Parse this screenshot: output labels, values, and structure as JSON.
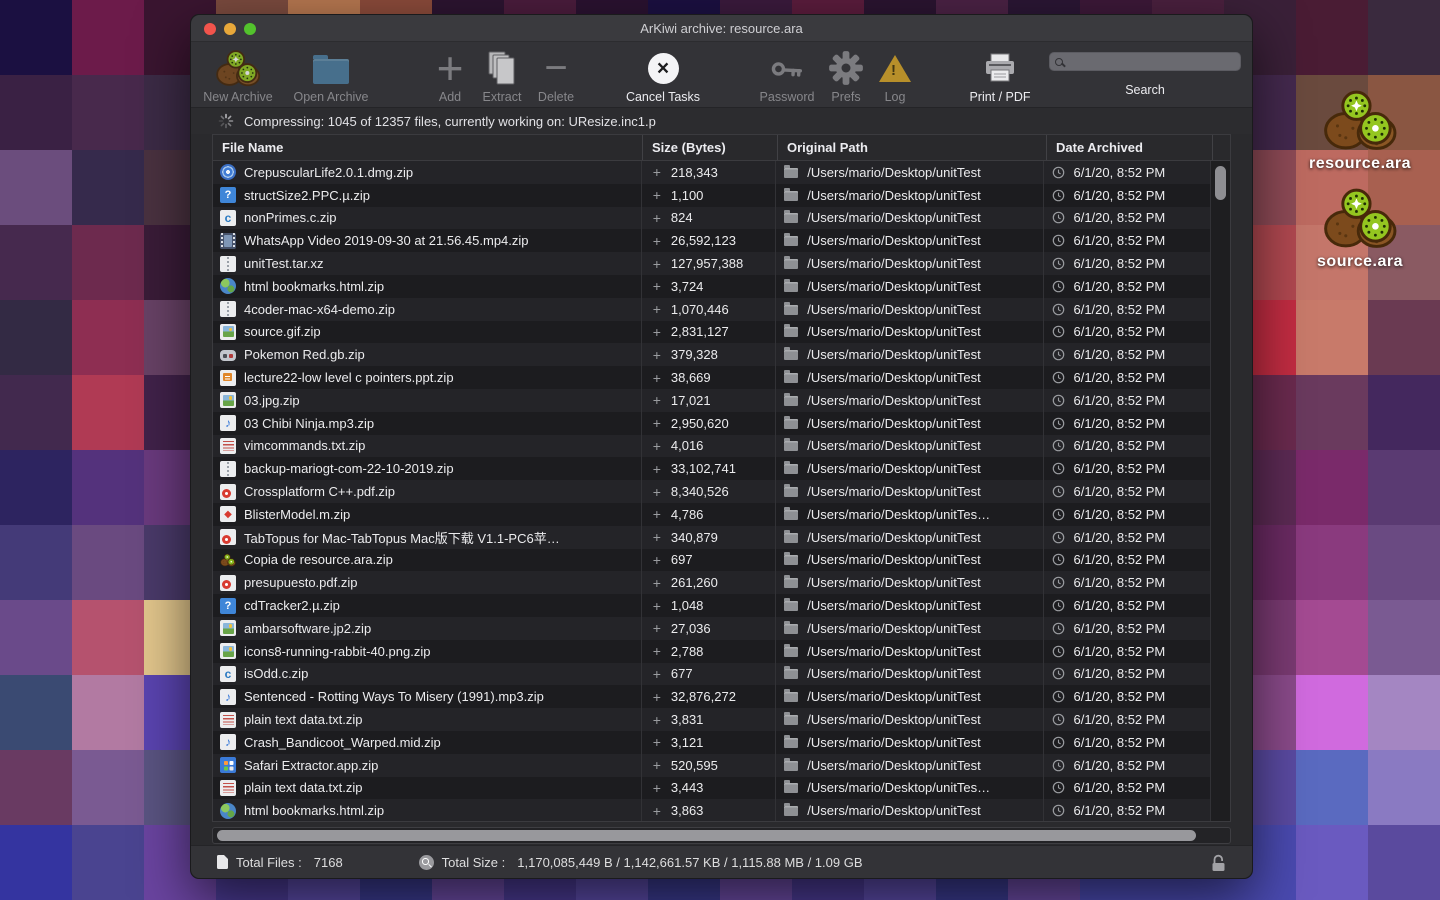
{
  "desktop": {
    "icons": [
      {
        "label": "resource.ara"
      },
      {
        "label": "source.ara"
      }
    ]
  },
  "background": {
    "tile_colors": [
      [
        "#1b1041",
        "#6c1b4a",
        "#3a1530",
        "#7a4a3e",
        "#b5764f",
        "#8a4a3a",
        "#2c1430",
        "#4a1c3c",
        "#2a1230",
        "#1b1041",
        "#3a1a3c",
        "#5a1c3c",
        "#2a1430",
        "#4a2244",
        "#2a1634",
        "#3c1838",
        "#4a203e",
        "#3a2038",
        "#4a1c34",
        "#3a2a3e"
      ],
      [
        "#3a2144",
        "#48294c",
        "#3c2b46",
        "#55305e",
        "#3a2348",
        "#54284e",
        "#42224a",
        "#2e1c3e",
        "#4a2a58",
        "#36204a",
        "#62325a",
        "#3c2444",
        "#502a52",
        "#44224e",
        "#3a2348",
        "#54284e",
        "#46284e",
        "#44294e",
        "#6a4a3e",
        "#8a5642"
      ],
      [
        "#6b4d7d",
        "#362a4c",
        "#4a3240",
        "#6a2a50",
        "#42224a",
        "#55305e",
        "#36204a",
        "#4a2a58",
        "#62325a",
        "#3c2444",
        "#502a52",
        "#44224e",
        "#3a2348",
        "#54284e",
        "#6a2a50",
        "#42224a",
        "#5c3050",
        "#8e4a56",
        "#bd6a60",
        "#a86050"
      ],
      [
        "#46294e",
        "#6d2a4e",
        "#3a1c38",
        "#54284e",
        "#6a2a50",
        "#36204a",
        "#55305e",
        "#3c2444",
        "#4a2a58",
        "#62325a",
        "#502a52",
        "#3a2348",
        "#44224e",
        "#6a2a50",
        "#54284e",
        "#7a3a5e",
        "#8e4252",
        "#b04850",
        "#c4766a",
        "#8a5a62"
      ],
      [
        "#332a44",
        "#8e2e52",
        "#684266",
        "#42224a",
        "#54284e",
        "#6a2a50",
        "#3c2444",
        "#55305e",
        "#36204a",
        "#4a2a58",
        "#62325a",
        "#502a52",
        "#3a2348",
        "#44224e",
        "#6a2a50",
        "#8a3a5e",
        "#a43a4e",
        "#c22c42",
        "#c87a6a",
        "#6a3a52"
      ],
      [
        "#42294e",
        "#b03a54",
        "#41224a",
        "#6a2a50",
        "#3c2444",
        "#54284e",
        "#55305e",
        "#36204a",
        "#62325a",
        "#4a2a58",
        "#502a52",
        "#44224e",
        "#3a2348",
        "#6a2a50",
        "#54284e",
        "#5c2a54",
        "#6a2a4e",
        "#6a2a4e",
        "#6a3a5e",
        "#44285e"
      ],
      [
        "#2d2460",
        "#54327c",
        "#6a3a7e",
        "#4a2a6a",
        "#55305e",
        "#3c2460",
        "#5a3270",
        "#44285e",
        "#4a2a58",
        "#62327a",
        "#502a6e",
        "#3a2360",
        "#44226a",
        "#6a2a72",
        "#54286a",
        "#5c2a64",
        "#5c2a54",
        "#5c2a54",
        "#7a2a6a",
        "#5a3a72"
      ],
      [
        "#443a78",
        "#6a4a80",
        "#4a3a6a",
        "#5a3a7e",
        "#4a2a6a",
        "#55307e",
        "#3c2460",
        "#5a3270",
        "#62327a",
        "#44285e",
        "#502a6e",
        "#4a2a58",
        "#3a2360",
        "#54286a",
        "#6a2a72",
        "#6a2a62",
        "#6a2a62",
        "#6a2a62",
        "#8a3a7e",
        "#6a4a82"
      ],
      [
        "#6a4a8a",
        "#b5526e",
        "#e2c68c",
        "#5a3a7e",
        "#55307e",
        "#4a2a6a",
        "#5a3270",
        "#3c2460",
        "#62327a",
        "#502a6e",
        "#44285e",
        "#3a2360",
        "#54286a",
        "#4a2a58",
        "#6a2a72",
        "#7a3a72",
        "#7a3a72",
        "#7a3a72",
        "#a44a92",
        "#7a5a92"
      ],
      [
        "#3a4a72",
        "#b27aa2",
        "#5a44b0",
        "#4a3a8a",
        "#5a3a7e",
        "#55307e",
        "#4a2a6a",
        "#5a3270",
        "#3c2460",
        "#62327a",
        "#502a6e",
        "#54286a",
        "#3a2360",
        "#44285e",
        "#6a2a72",
        "#8a4a8a",
        "#8a4a8a",
        "#8a4a8a",
        "#d06ade",
        "#a486c2"
      ],
      [
        "#693a62",
        "#7a5a92",
        "#5a5482",
        "#5a44b0",
        "#4a3a8a",
        "#5a3a7e",
        "#55307e",
        "#4a2a6a",
        "#5a3270",
        "#62327a",
        "#3c2460",
        "#502a6e",
        "#54286a",
        "#3a2360",
        "#44285e",
        "#5a4aa2",
        "#5a4aa2",
        "#5a4aa2",
        "#5a6ac0",
        "#8a7ac2"
      ],
      [
        "#3434a0",
        "#4a4490",
        "#6a44a0",
        "#4a3a92",
        "#5a4aa6",
        "#3a3a8e",
        "#6a4aa2",
        "#4a3a92",
        "#5a4aa6",
        "#3a3a8e",
        "#6a4aa2",
        "#4a3a92",
        "#5a4aa6",
        "#3a3a8e",
        "#6a4aa2",
        "#4a4ab0",
        "#4a4ab0",
        "#4a4ab0",
        "#6a5ac0",
        "#5a4a9e"
      ]
    ]
  },
  "window": {
    "title": "ArKiwi archive: resource.ara",
    "toolbar": {
      "items": [
        {
          "id": "new-archive",
          "label": "New Archive",
          "icon": "kiwi",
          "enabled": false
        },
        {
          "id": "open-archive",
          "label": "Open Archive",
          "icon": "folder",
          "enabled": false
        },
        {
          "id": "add",
          "label": "Add",
          "icon": "plus",
          "enabled": false
        },
        {
          "id": "extract",
          "label": "Extract",
          "icon": "docs",
          "enabled": false
        },
        {
          "id": "delete",
          "label": "Delete",
          "icon": "minus",
          "enabled": false
        },
        {
          "id": "cancel-tasks",
          "label": "Cancel Tasks",
          "icon": "cancel",
          "enabled": true
        },
        {
          "id": "password",
          "label": "Password",
          "icon": "key",
          "enabled": false
        },
        {
          "id": "prefs",
          "label": "Prefs",
          "icon": "gear",
          "enabled": false
        },
        {
          "id": "log",
          "label": "Log",
          "icon": "warning",
          "enabled": false
        },
        {
          "id": "print-pdf",
          "label": "Print / PDF",
          "icon": "printer",
          "enabled": true
        }
      ],
      "search_label": "Search",
      "search_value": ""
    },
    "progress": {
      "text": "Compressing: 1045 of 12357 files, currently working on:  UResize.inc1.p"
    },
    "table": {
      "columns": [
        "File Name",
        "Size (Bytes)",
        "Original Path",
        "Date Archived"
      ],
      "rows": [
        {
          "icon": "disc",
          "name": "CrepuscularLife2.0.1.dmg.zip",
          "size": "218,343",
          "path": "/Users/mario/Desktop/unitTest",
          "date": "6/1/20, 8:52 PM"
        },
        {
          "icon": "docq",
          "name": "structSize2.PPC.µ.zip",
          "size": "1,100",
          "path": "/Users/mario/Desktop/unitTest",
          "date": "6/1/20, 8:52 PM"
        },
        {
          "icon": "docc",
          "name": "nonPrimes.c.zip",
          "size": "824",
          "path": "/Users/mario/Desktop/unitTest",
          "date": "6/1/20, 8:52 PM"
        },
        {
          "icon": "video",
          "name": "WhatsApp Video 2019-09-30 at 21.56.45.mp4.zip",
          "size": "26,592,123",
          "path": "/Users/mario/Desktop/unitTest",
          "date": "6/1/20, 8:52 PM"
        },
        {
          "icon": "zip",
          "name": "unitTest.tar.xz",
          "size": "127,957,388",
          "path": "/Users/mario/Desktop/unitTest",
          "date": "6/1/20, 8:52 PM"
        },
        {
          "icon": "globe",
          "name": "html bookmarks.html.zip",
          "size": "3,724",
          "path": "/Users/mario/Desktop/unitTest",
          "date": "6/1/20, 8:52 PM"
        },
        {
          "icon": "zip",
          "name": "4coder-mac-x64-demo.zip",
          "size": "1,070,446",
          "path": "/Users/mario/Desktop/unitTest",
          "date": "6/1/20, 8:52 PM"
        },
        {
          "icon": "img",
          "name": "source.gif.zip",
          "size": "2,831,127",
          "path": "/Users/mario/Desktop/unitTest",
          "date": "6/1/20, 8:52 PM"
        },
        {
          "icon": "game",
          "name": "Pokemon Red.gb.zip",
          "size": "379,328",
          "path": "/Users/mario/Desktop/unitTest",
          "date": "6/1/20, 8:52 PM"
        },
        {
          "icon": "ppt",
          "name": "lecture22-low level c pointers.ppt.zip",
          "size": "38,669",
          "path": "/Users/mario/Desktop/unitTest",
          "date": "6/1/20, 8:52 PM"
        },
        {
          "icon": "img",
          "name": "03.jpg.zip",
          "size": "17,021",
          "path": "/Users/mario/Desktop/unitTest",
          "date": "6/1/20, 8:52 PM"
        },
        {
          "icon": "music",
          "name": "03 Chibi Ninja.mp3.zip",
          "size": "2,950,620",
          "path": "/Users/mario/Desktop/unitTest",
          "date": "6/1/20, 8:52 PM"
        },
        {
          "icon": "text",
          "name": "vimcommands.txt.zip",
          "size": "4,016",
          "path": "/Users/mario/Desktop/unitTest",
          "date": "6/1/20, 8:52 PM"
        },
        {
          "icon": "zip",
          "name": "backup-mariogt-com-22-10-2019.zip",
          "size": "33,102,741",
          "path": "/Users/mario/Desktop/unitTest",
          "date": "6/1/20, 8:52 PM"
        },
        {
          "icon": "pdf",
          "name": "Crossplatform C++.pdf.zip",
          "size": "8,340,526",
          "path": "/Users/mario/Desktop/unitTest",
          "date": "6/1/20, 8:52 PM"
        },
        {
          "icon": "docm",
          "name": "BlisterModel.m.zip",
          "size": "4,786",
          "path": "/Users/mario/Desktop/unitTes…",
          "date": "6/1/20, 8:52 PM"
        },
        {
          "icon": "pdf",
          "name": "TabTopus for Mac-TabTopus Mac版下载 V1.1-PC6苹…",
          "size": "340,879",
          "path": "/Users/mario/Desktop/unitTest",
          "date": "6/1/20, 8:52 PM"
        },
        {
          "icon": "kiwi",
          "name": "Copia de resource.ara.zip",
          "size": "697",
          "path": "/Users/mario/Desktop/unitTest",
          "date": "6/1/20, 8:52 PM"
        },
        {
          "icon": "pdf",
          "name": "presupuesto.pdf.zip",
          "size": "261,260",
          "path": "/Users/mario/Desktop/unitTest",
          "date": "6/1/20, 8:52 PM"
        },
        {
          "icon": "docq",
          "name": "cdTracker2.µ.zip",
          "size": "1,048",
          "path": "/Users/mario/Desktop/unitTest",
          "date": "6/1/20, 8:52 PM"
        },
        {
          "icon": "img",
          "name": "ambarsoftware.jp2.zip",
          "size": "27,036",
          "path": "/Users/mario/Desktop/unitTest",
          "date": "6/1/20, 8:52 PM"
        },
        {
          "icon": "img",
          "name": "icons8-running-rabbit-40.png.zip",
          "size": "2,788",
          "path": "/Users/mario/Desktop/unitTest",
          "date": "6/1/20, 8:52 PM"
        },
        {
          "icon": "docc",
          "name": "isOdd.c.zip",
          "size": "677",
          "path": "/Users/mario/Desktop/unitTest",
          "date": "6/1/20, 8:52 PM"
        },
        {
          "icon": "music",
          "name": "Sentenced - Rotting Ways To Misery (1991).mp3.zip",
          "size": "32,876,272",
          "path": "/Users/mario/Desktop/unitTest",
          "date": "6/1/20, 8:52 PM"
        },
        {
          "icon": "text",
          "name": "plain text data.txt.zip",
          "size": "3,831",
          "path": "/Users/mario/Desktop/unitTest",
          "date": "6/1/20, 8:52 PM"
        },
        {
          "icon": "music",
          "name": "Crash_Bandicoot_Warped.mid.zip",
          "size": "3,121",
          "path": "/Users/mario/Desktop/unitTest",
          "date": "6/1/20, 8:52 PM"
        },
        {
          "icon": "app",
          "name": "Safari Extractor.app.zip",
          "size": "520,595",
          "path": "/Users/mario/Desktop/unitTest",
          "date": "6/1/20, 8:52 PM"
        },
        {
          "icon": "text",
          "name": "plain text data.txt.zip",
          "size": "3,443",
          "path": "/Users/mario/Desktop/unitTes…",
          "date": "6/1/20, 8:52 PM"
        },
        {
          "icon": "globe",
          "name": "html bookmarks.html.zip",
          "size": "3,863",
          "path": "/Users/mario/Desktop/unitTest",
          "date": "6/1/20, 8:52 PM"
        }
      ]
    },
    "statusbar": {
      "total_files_label": "Total Files :",
      "total_files": "7168",
      "total_size_label": "Total Size :",
      "total_size": "1,170,085,449 B / 1,142,661.57 KB / 1,115.88 MB / 1.09 GB"
    }
  },
  "colors": {
    "accent_warning": "#d9a728",
    "traffic_red": "#f2544c",
    "traffic_yellow": "#e8a83a",
    "traffic_green": "#53c22d"
  }
}
